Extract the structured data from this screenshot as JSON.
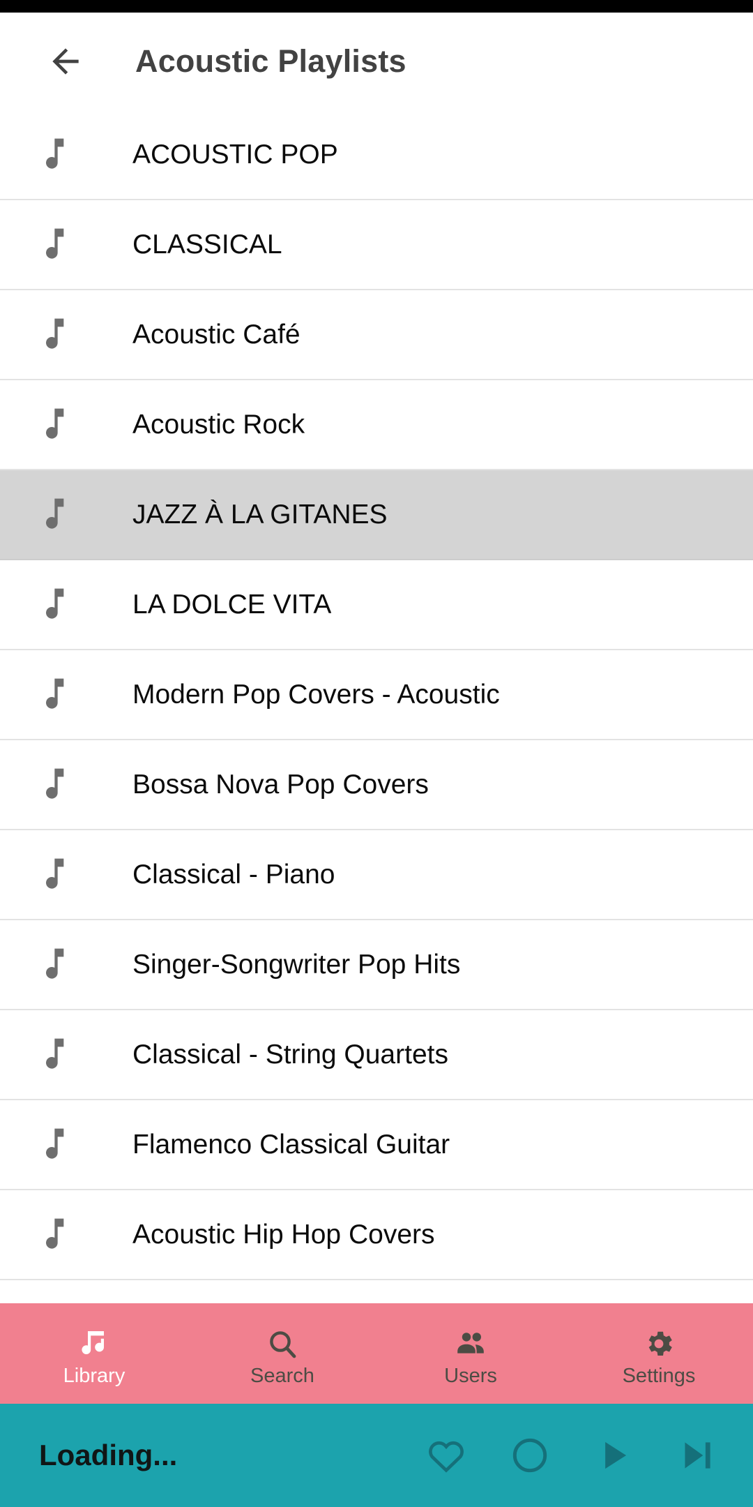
{
  "app_bar": {
    "back_icon": "arrow-left-icon",
    "title": "Acoustic Playlists"
  },
  "list": {
    "item_icon": "music-note-icon",
    "items": [
      {
        "label": "ACOUSTIC POP",
        "selected": false
      },
      {
        "label": "CLASSICAL",
        "selected": false
      },
      {
        "label": "Acoustic Café",
        "selected": false
      },
      {
        "label": "Acoustic Rock",
        "selected": false
      },
      {
        "label": "JAZZ À LA GITANES",
        "selected": true
      },
      {
        "label": "LA DOLCE VITA",
        "selected": false
      },
      {
        "label": "Modern Pop Covers - Acoustic",
        "selected": false
      },
      {
        "label": "Bossa Nova Pop Covers",
        "selected": false
      },
      {
        "label": "Classical - Piano",
        "selected": false
      },
      {
        "label": "Singer-Songwriter Pop Hits",
        "selected": false
      },
      {
        "label": "Classical - String Quartets",
        "selected": false
      },
      {
        "label": "Flamenco Classical Guitar",
        "selected": false
      },
      {
        "label": "Acoustic Hip Hop Covers",
        "selected": false
      }
    ]
  },
  "tab_bar": {
    "background_color": "#f1808f",
    "active_color": "#ffffff",
    "inactive_color": "#4c4c44",
    "tabs": [
      {
        "label": "Library",
        "icon": "library-music-icon",
        "active": true
      },
      {
        "label": "Search",
        "icon": "search-icon",
        "active": false
      },
      {
        "label": "Users",
        "icon": "users-icon",
        "active": false
      },
      {
        "label": "Settings",
        "icon": "gear-icon",
        "active": false
      }
    ]
  },
  "player_bar": {
    "background_color": "#1ca3ad",
    "icon_color": "#15707a",
    "title": "Loading...",
    "controls": [
      {
        "name": "favorite-button",
        "icon": "heart-icon"
      },
      {
        "name": "repeat-button",
        "icon": "circle-icon"
      },
      {
        "name": "play-button",
        "icon": "play-icon"
      },
      {
        "name": "next-button",
        "icon": "skip-next-icon"
      }
    ]
  }
}
